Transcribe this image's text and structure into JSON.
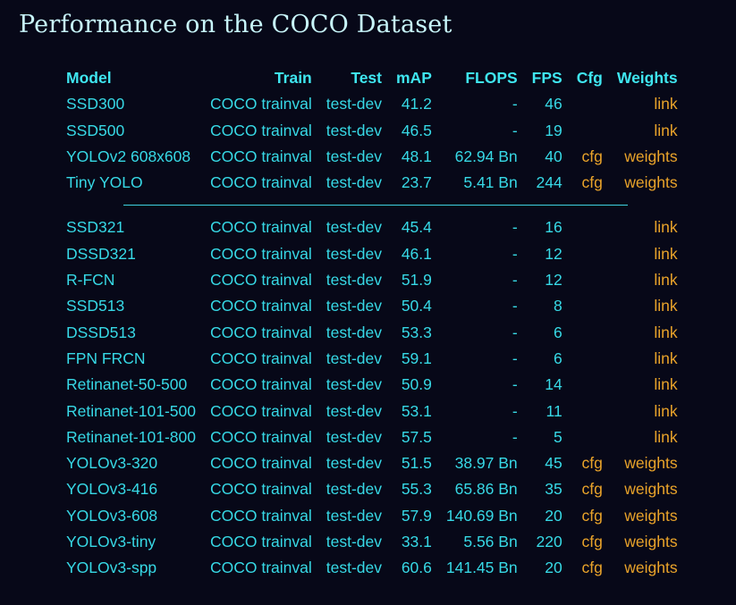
{
  "title": "Performance on the COCO Dataset",
  "headers": {
    "model": "Model",
    "train": "Train",
    "test": "Test",
    "map": "mAP",
    "flops": "FLOPS",
    "fps": "FPS",
    "cfg": "Cfg",
    "weights": "Weights"
  },
  "rows_group1": [
    {
      "model": "SSD300",
      "train": "COCO trainval",
      "test": "test-dev",
      "map": "41.2",
      "flops": "-",
      "fps": "46",
      "cfg": "",
      "weights": "link"
    },
    {
      "model": "SSD500",
      "train": "COCO trainval",
      "test": "test-dev",
      "map": "46.5",
      "flops": "-",
      "fps": "19",
      "cfg": "",
      "weights": "link"
    },
    {
      "model": "YOLOv2 608x608",
      "train": "COCO trainval",
      "test": "test-dev",
      "map": "48.1",
      "flops": "62.94 Bn",
      "fps": "40",
      "cfg": "cfg",
      "weights": "weights"
    },
    {
      "model": "Tiny YOLO",
      "train": "COCO trainval",
      "test": "test-dev",
      "map": "23.7",
      "flops": "5.41 Bn",
      "fps": "244",
      "cfg": "cfg",
      "weights": "weights"
    }
  ],
  "rows_group2": [
    {
      "model": "SSD321",
      "train": "COCO trainval",
      "test": "test-dev",
      "map": "45.4",
      "flops": "-",
      "fps": "16",
      "cfg": "",
      "weights": "link"
    },
    {
      "model": "DSSD321",
      "train": "COCO trainval",
      "test": "test-dev",
      "map": "46.1",
      "flops": "-",
      "fps": "12",
      "cfg": "",
      "weights": "link"
    },
    {
      "model": "R-FCN",
      "train": "COCO trainval",
      "test": "test-dev",
      "map": "51.9",
      "flops": "-",
      "fps": "12",
      "cfg": "",
      "weights": "link"
    },
    {
      "model": "SSD513",
      "train": "COCO trainval",
      "test": "test-dev",
      "map": "50.4",
      "flops": "-",
      "fps": "8",
      "cfg": "",
      "weights": "link"
    },
    {
      "model": "DSSD513",
      "train": "COCO trainval",
      "test": "test-dev",
      "map": "53.3",
      "flops": "-",
      "fps": "6",
      "cfg": "",
      "weights": "link"
    },
    {
      "model": "FPN FRCN",
      "train": "COCO trainval",
      "test": "test-dev",
      "map": "59.1",
      "flops": "-",
      "fps": "6",
      "cfg": "",
      "weights": "link"
    },
    {
      "model": "Retinanet-50-500",
      "train": "COCO trainval",
      "test": "test-dev",
      "map": "50.9",
      "flops": "-",
      "fps": "14",
      "cfg": "",
      "weights": "link"
    },
    {
      "model": "Retinanet-101-500",
      "train": "COCO trainval",
      "test": "test-dev",
      "map": "53.1",
      "flops": "-",
      "fps": "11",
      "cfg": "",
      "weights": "link"
    },
    {
      "model": "Retinanet-101-800",
      "train": "COCO trainval",
      "test": "test-dev",
      "map": "57.5",
      "flops": "-",
      "fps": "5",
      "cfg": "",
      "weights": "link"
    },
    {
      "model": "YOLOv3-320",
      "train": "COCO trainval",
      "test": "test-dev",
      "map": "51.5",
      "flops": "38.97 Bn",
      "fps": "45",
      "cfg": "cfg",
      "weights": "weights"
    },
    {
      "model": "YOLOv3-416",
      "train": "COCO trainval",
      "test": "test-dev",
      "map": "55.3",
      "flops": "65.86 Bn",
      "fps": "35",
      "cfg": "cfg",
      "weights": "weights"
    },
    {
      "model": "YOLOv3-608",
      "train": "COCO trainval",
      "test": "test-dev",
      "map": "57.9",
      "flops": "140.69 Bn",
      "fps": "20",
      "cfg": "cfg",
      "weights": "weights"
    },
    {
      "model": "YOLOv3-tiny",
      "train": "COCO trainval",
      "test": "test-dev",
      "map": "33.1",
      "flops": "5.56 Bn",
      "fps": "220",
      "cfg": "cfg",
      "weights": "weights"
    },
    {
      "model": "YOLOv3-spp",
      "train": "COCO trainval",
      "test": "test-dev",
      "map": "60.6",
      "flops": "141.45 Bn",
      "fps": "20",
      "cfg": "cfg",
      "weights": "weights"
    }
  ],
  "colors": {
    "background": "#070818",
    "text": "#37d9e6",
    "header": "#3fe6f0",
    "link": "#e9a32a",
    "title": "#c8f6fb"
  }
}
